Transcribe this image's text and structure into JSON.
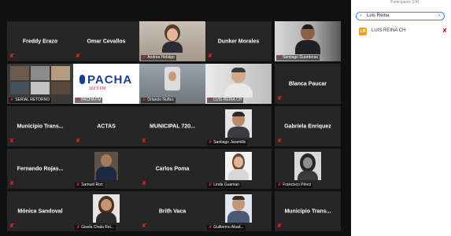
{
  "gallery": {
    "row1": {
      "t1_name": "Freddy Erazo",
      "t2_name": "Omar Cevallos",
      "t3_caption": "Andrea Hidalgo",
      "t4_name": "Dunker Morales",
      "t5_caption": "Santiago Guarderas"
    },
    "row2": {
      "t1_caption": "SERIAL RETORNO",
      "t2_caption": "PACHA FM",
      "t2_logo": "PACHA",
      "t2_logo_sub": "102.9 FM",
      "t3_caption": "Orlando Nuñez",
      "t4_caption": "LUIS REINA CH",
      "t5_name": "Blanca Paucar"
    },
    "row3": {
      "t1_name": "Municipio Trans...",
      "t2_name": "ACTAS",
      "t3_name": "MUNICIPAL 720...",
      "t4_caption": "Santiago Jaramillo",
      "t5_name": "Gabriela Enriquez"
    },
    "row4": {
      "t1_name": "Fernando Rojas...",
      "t2_caption": "Samuel Ron",
      "t3_name": "Carlos Poma",
      "t4_caption": "Linda Guaman",
      "t5_caption": "Francisco Pérez"
    },
    "row5": {
      "t1_name": "Mónica Sandoval",
      "t2_caption": "Gisela Chala Rei...",
      "t3_name": "Brith Vaca",
      "t4_caption": "Guillermo Abad...",
      "t5_name": "Municipio Trans..."
    },
    "mic_glyph": "✘"
  },
  "panel": {
    "title": "Participants (24)",
    "search_value": "Luis Reina",
    "search_icon": "⌕",
    "clear_icon": "✕",
    "result_initials": "LR",
    "result_name": "LUIS REINA CH",
    "result_mic": "✘"
  },
  "colors": {
    "muted": "#e02020",
    "tile_bg": "#262626",
    "gallery_bg": "#101010",
    "accent": "#2d8cff"
  }
}
